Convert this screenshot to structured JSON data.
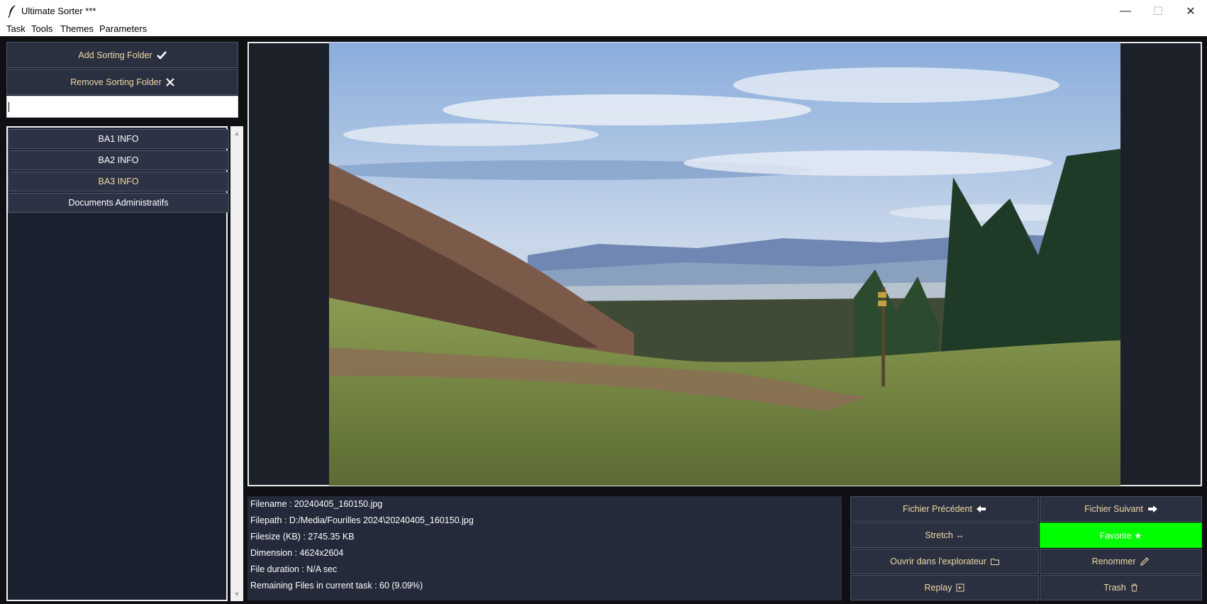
{
  "window": {
    "title": "Ultimate Sorter ***",
    "controls": {
      "minimize": "—",
      "maximize": "☐",
      "close": "✕"
    }
  },
  "menu": [
    "Task",
    "Tools",
    "Themes",
    "Parameters"
  ],
  "sidebar": {
    "add_label": "Add Sorting Folder",
    "remove_label": "Remove Sorting Folder",
    "folder_input_value": "",
    "folders": [
      "BA1 INFO",
      "BA2 INFO",
      "BA3 INFO",
      "Documents Administratifs"
    ],
    "scroll_up": "▲",
    "scroll_down": "▼"
  },
  "info": {
    "filename": "Filename : 20240405_160150.jpg",
    "filepath": "Filepath : D:/Media/Fourilles 2024\\20240405_160150.jpg",
    "filesize": "Filesize (KB) : 2745.35 KB",
    "dimension": "Dimension : 4624x2604",
    "duration": "File duration : N/A sec",
    "remaining": "Remaining Files in current task : 60 (9.09%)"
  },
  "actions": {
    "previous_label": "Fichier Précédent",
    "next_label": "Fichier Suivant",
    "stretch_label": "Stretch ↔",
    "favorite_label": "Favorite ★",
    "open_explorer_label": "Ouvrir dans l'explorateur",
    "rename_label": "Renommer",
    "replay_label": "Replay",
    "trash_label": "Trash"
  },
  "colors": {
    "background": "#0e1014",
    "button": "#2a3040",
    "button_text": "#f0d9a6",
    "favorite_active": "#00ff00",
    "info_panel": "#252a3a"
  },
  "icons": {
    "add": "check-icon",
    "remove": "cross-icon",
    "previous": "arrow-left-icon",
    "next": "arrow-right-icon",
    "open_explorer": "folder-icon",
    "rename": "pencil-icon",
    "replay": "replay-icon",
    "trash": "trash-icon"
  }
}
